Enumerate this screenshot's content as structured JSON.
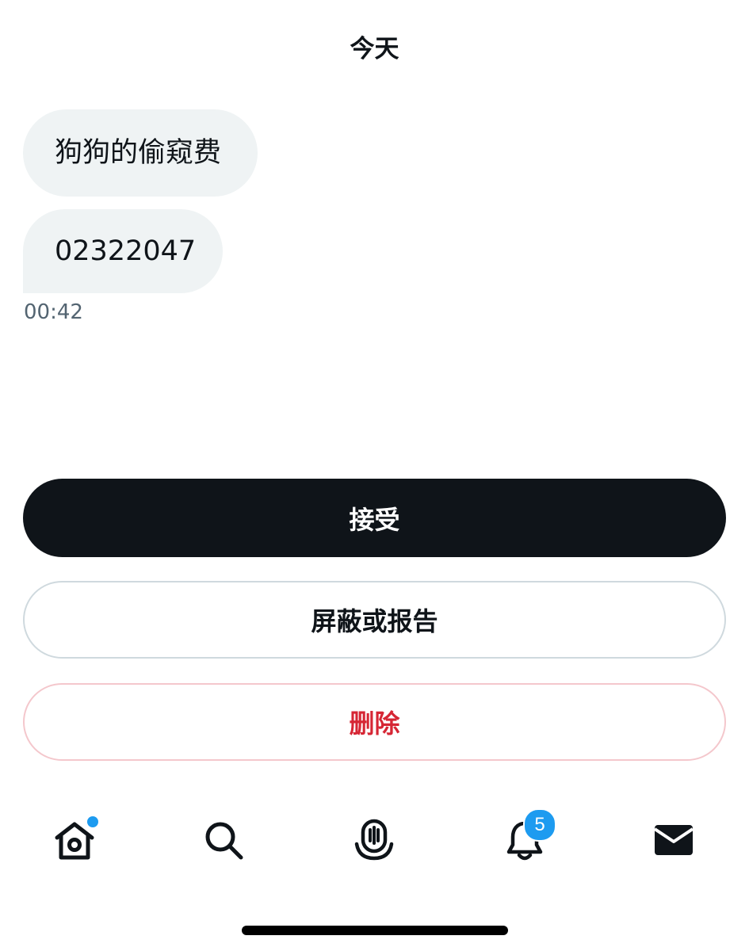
{
  "conversation": {
    "date_header": "今天",
    "messages": [
      {
        "text": "狗狗的偷窥费"
      },
      {
        "text": "02322047"
      }
    ],
    "last_time": "00:42"
  },
  "request_actions": {
    "accept_label": "接受",
    "block_report_label": "屏蔽或报告",
    "delete_label": "删除"
  },
  "tab_bar": {
    "tabs": [
      {
        "icon": "home-icon",
        "has_dot": true
      },
      {
        "icon": "search-icon"
      },
      {
        "icon": "spaces-icon"
      },
      {
        "icon": "bell-icon",
        "badge": "5"
      },
      {
        "icon": "mail-icon"
      }
    ]
  },
  "colors": {
    "primary_text": "#0f1419",
    "secondary_text": "#536471",
    "bubble_bg": "#eff3f4",
    "accent_blue": "#1d9bf0",
    "delete_red": "#d62634"
  }
}
